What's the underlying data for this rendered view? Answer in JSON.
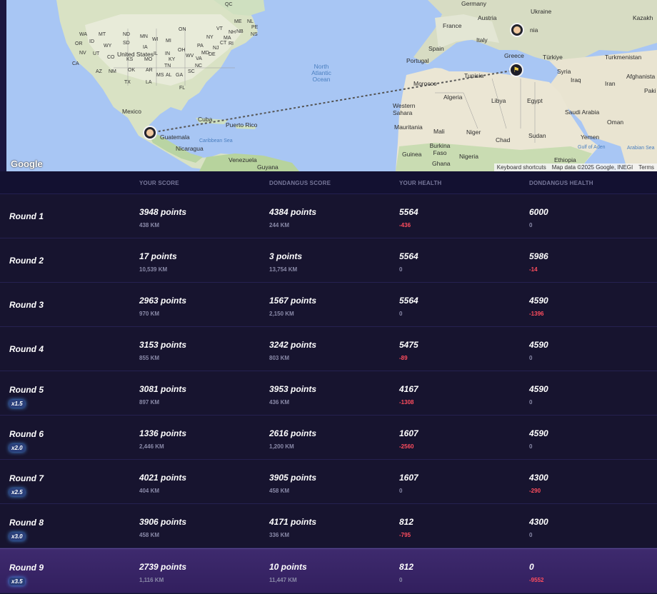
{
  "map": {
    "labels": {
      "germany": "Germany",
      "ukraine": "Ukraine",
      "austria": "Austria",
      "france": "France",
      "italy": "Italy",
      "spain": "Spain",
      "portugal": "Portugal",
      "greece": "Greece",
      "turkiye": "Türkiye",
      "turkmenistan": "Turkmenistan",
      "kazakh": "Kazakh",
      "afghanista": "Afghanista",
      "syria": "Syria",
      "iraq": "Iraq",
      "iran": "Iran",
      "paki": "Paki",
      "tunisia": "Tunisia",
      "morocco": "Morocco",
      "algeria": "Algeria",
      "libya": "Libya",
      "egypt": "Egypt",
      "saudi_arabia": "Saudi Arabia",
      "oman": "Oman",
      "yemen": "Yemen",
      "western_sahara": "Western Sahara",
      "mauritania": "Mauritania",
      "mali": "Mali",
      "niger": "Niger",
      "chad": "Chad",
      "sudan": "Sudan",
      "burkina_faso": "Burkina Faso",
      "guinea": "Guinea",
      "ghana": "Ghana",
      "nigeria": "Nigeria",
      "ethiopia": "Ethiopia",
      "gulf_of_aden": "Gulf of Aden",
      "arabian_sea": "Arabian Sea",
      "united_states": "United States",
      "mexico": "Mexico",
      "cuba": "Cuba",
      "puerto_rico": "Puerto Rico",
      "guatemala": "Guatemala",
      "nicaragua": "Nicaragua",
      "caribbean_sea": "Caribbean Sea",
      "venezuela": "Venezuela",
      "guyana": "Guyana",
      "north_atlantic_ocean": "North Atlantic Ocean",
      "nia": "nia",
      "qc": "QC",
      "nb": "NB",
      "ns": "NS",
      "pe": "PE",
      "nl": "NL",
      "wa": "WA",
      "mt": "MT",
      "nd": "ND",
      "mn": "MN",
      "or": "OR",
      "id": "ID",
      "wy": "WY",
      "sd": "SD",
      "ia": "IA",
      "nv": "NV",
      "ut": "UT",
      "co": "CO",
      "ks": "KS",
      "mo": "MO",
      "ca": "CA",
      "az": "AZ",
      "nm": "NM",
      "ok": "OK",
      "ar": "AR",
      "tx": "TX",
      "la": "LA",
      "ms": "MS",
      "al": "AL",
      "ga": "GA",
      "fl": "FL",
      "tn": "TN",
      "ky": "KY",
      "oh": "OH",
      "in": "IN",
      "il": "IL",
      "wi": "WI",
      "mi": "MI",
      "pa": "PA",
      "ny": "NY",
      "va": "VA",
      "nc": "NC",
      "sc": "SC",
      "wv": "WV",
      "me": "ME",
      "vt": "VT",
      "nh": "NH",
      "ma": "MA",
      "ct": "CT",
      "ri": "RI",
      "nj": "NJ",
      "de": "DE",
      "md": "MD",
      "on": "ON"
    },
    "google": "Google",
    "keyboard_shortcuts": "Keyboard shortcuts",
    "map_data": "Map data ©2025 Google, INEGI",
    "terms": "Terms"
  },
  "table": {
    "headers": [
      "",
      "YOUR SCORE",
      "DONDANGUS SCORE",
      "YOUR HEALTH",
      "DONDANGUS HEALTH"
    ],
    "rows": [
      {
        "round": "Round 1",
        "mult": "",
        "your_score": "3948 points",
        "your_dist": "438 KM",
        "opp_score": "4384 points",
        "opp_dist": "244 KM",
        "your_health": "5564",
        "your_delta": "-436",
        "opp_health": "6000",
        "opp_delta": "0"
      },
      {
        "round": "Round 2",
        "mult": "",
        "your_score": "17 points",
        "your_dist": "10,539 KM",
        "opp_score": "3 points",
        "opp_dist": "13,754 KM",
        "your_health": "5564",
        "your_delta": "0",
        "opp_health": "5986",
        "opp_delta": "-14"
      },
      {
        "round": "Round 3",
        "mult": "",
        "your_score": "2963 points",
        "your_dist": "970 KM",
        "opp_score": "1567 points",
        "opp_dist": "2,150 KM",
        "your_health": "5564",
        "your_delta": "0",
        "opp_health": "4590",
        "opp_delta": "-1396"
      },
      {
        "round": "Round 4",
        "mult": "",
        "your_score": "3153 points",
        "your_dist": "855 KM",
        "opp_score": "3242 points",
        "opp_dist": "803 KM",
        "your_health": "5475",
        "your_delta": "-89",
        "opp_health": "4590",
        "opp_delta": "0"
      },
      {
        "round": "Round 5",
        "mult": "x1.5",
        "your_score": "3081 points",
        "your_dist": "897 KM",
        "opp_score": "3953 points",
        "opp_dist": "436 KM",
        "your_health": "4167",
        "your_delta": "-1308",
        "opp_health": "4590",
        "opp_delta": "0"
      },
      {
        "round": "Round 6",
        "mult": "x2.0",
        "your_score": "1336 points",
        "your_dist": "2,446 KM",
        "opp_score": "2616 points",
        "opp_dist": "1,200 KM",
        "your_health": "1607",
        "your_delta": "-2560",
        "opp_health": "4590",
        "opp_delta": "0"
      },
      {
        "round": "Round 7",
        "mult": "x2.5",
        "your_score": "4021 points",
        "your_dist": "404 KM",
        "opp_score": "3905 points",
        "opp_dist": "458 KM",
        "your_health": "1607",
        "your_delta": "0",
        "opp_health": "4300",
        "opp_delta": "-290"
      },
      {
        "round": "Round 8",
        "mult": "x3.0",
        "your_score": "3906 points",
        "your_dist": "458 KM",
        "opp_score": "4171 points",
        "opp_dist": "336 KM",
        "your_health": "812",
        "your_delta": "-795",
        "opp_health": "4300",
        "opp_delta": "0"
      },
      {
        "round": "Round 9",
        "mult": "x3.5",
        "your_score": "2739 points",
        "your_dist": "1,116 KM",
        "opp_score": "10 points",
        "opp_dist": "11,447 KM",
        "your_health": "812",
        "your_delta": "0",
        "opp_health": "0",
        "opp_delta": "-9552"
      }
    ]
  }
}
